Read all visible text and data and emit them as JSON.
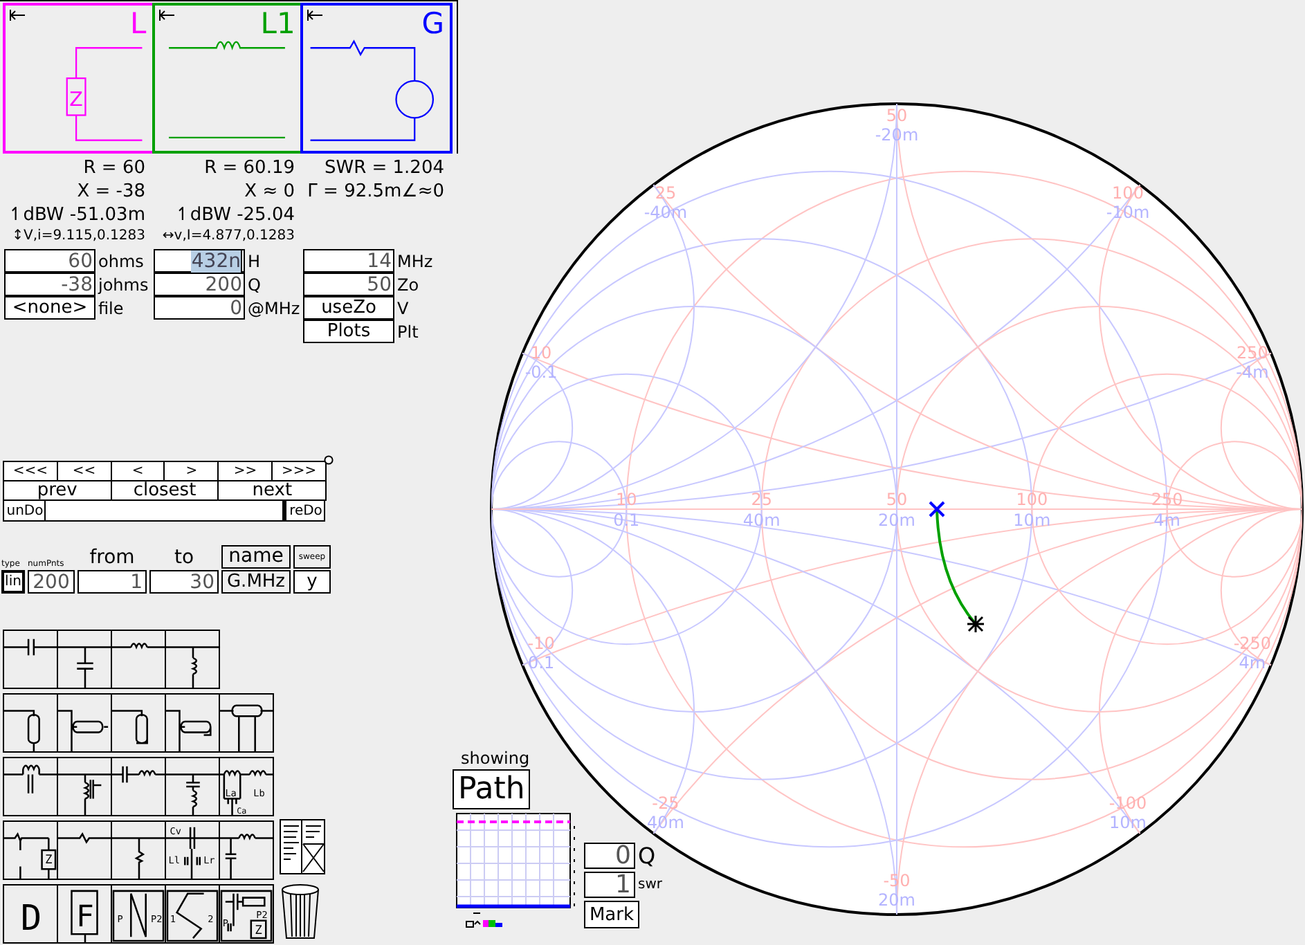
{
  "circuit": {
    "panels": [
      {
        "label": "L",
        "color": "#ff00ff",
        "kind": "load",
        "part_label": "Z"
      },
      {
        "label": "L1",
        "color": "#00a000",
        "kind": "inductor"
      },
      {
        "label": "G",
        "color": "#0000ff",
        "kind": "generator"
      }
    ]
  },
  "readouts": [
    [
      {
        "text": "R = 60",
        "kind": "main"
      },
      {
        "text": "X = -38",
        "kind": "main"
      },
      {
        "text": "↿dBW -51.03m",
        "kind": "main"
      },
      {
        "text": "↕V,i=9.115,0.1283",
        "kind": "small"
      }
    ],
    [
      {
        "text": "R = 60.19",
        "kind": "main"
      },
      {
        "text": "X ≈ 0",
        "kind": "main"
      },
      {
        "text": "↿dBW -25.04",
        "kind": "main"
      },
      {
        "text": "↔v,I=4.877,0.1283",
        "kind": "small"
      }
    ],
    [
      {
        "text": "SWR = 1.204",
        "kind": "main"
      },
      {
        "text": "Γ = 92.5m∠≈0",
        "kind": "main"
      }
    ]
  ],
  "inputs": [
    {
      "rows": [
        {
          "kind": "field",
          "value": "60",
          "unit": "ohms",
          "selected": false
        },
        {
          "kind": "field",
          "value": "-38",
          "unit": "johms",
          "selected": false
        },
        {
          "kind": "button",
          "value": "<none>",
          "unit": "file"
        }
      ]
    },
    {
      "rows": [
        {
          "kind": "field",
          "value": "432n",
          "unit": "H",
          "selected": true
        },
        {
          "kind": "field",
          "value": "200",
          "unit": "Q",
          "selected": false
        },
        {
          "kind": "field",
          "value": "0",
          "unit": "@MHz",
          "selected": false
        }
      ]
    },
    {
      "rows": [
        {
          "kind": "field",
          "value": "14",
          "unit": "MHz",
          "selected": false
        },
        {
          "kind": "field",
          "value": "50",
          "unit": "Zo",
          "selected": false
        },
        {
          "kind": "button",
          "value": "useZo",
          "unit": "V"
        },
        {
          "kind": "button",
          "value": "Plots",
          "unit": "Plt"
        }
      ]
    }
  ],
  "nav": {
    "steps": [
      "<<<",
      "<<",
      "<",
      ">",
      ">>",
      ">>>"
    ],
    "jumps": [
      "prev",
      "closest",
      "next"
    ],
    "undo": "unDo",
    "redo": "reDo"
  },
  "sweep": {
    "type_label": "type",
    "points_label": "numPnts",
    "from_label": "from",
    "to_label": "to",
    "name_label": "name",
    "sweep_label": "sweep",
    "type": "lin",
    "points": "200",
    "from": "1",
    "to": "30",
    "name": "G.MHz",
    "sweep": "y"
  },
  "palette": {
    "rows": [
      [
        {
          "kind": "series-cap"
        },
        {
          "kind": "shunt-cap"
        },
        {
          "kind": "series-ind"
        },
        {
          "kind": "shunt-ind"
        }
      ],
      [
        {
          "kind": "stub-open"
        },
        {
          "kind": "stub-side"
        },
        {
          "kind": "stub-short"
        },
        {
          "kind": "stub-side-short"
        },
        {
          "kind": "line"
        }
      ],
      [
        {
          "kind": "parallel-lc"
        },
        {
          "kind": "transformer"
        },
        {
          "kind": "series-lc"
        },
        {
          "kind": "shunt-lc"
        },
        {
          "kind": "trap",
          "labels": [
            "La",
            "Lb",
            "Ca"
          ]
        }
      ],
      [
        {
          "kind": "source",
          "labels": [
            "Z"
          ]
        },
        {
          "kind": "series-res"
        },
        {
          "kind": "shunt-res"
        },
        {
          "kind": "coupled",
          "labels": [
            "Cv",
            "Ll",
            "Lr"
          ]
        },
        {
          "kind": "pi"
        }
      ],
      [
        {
          "kind": "letter",
          "labels": [
            "D"
          ]
        },
        {
          "kind": "boxed-letter",
          "labels": [
            "F"
          ]
        },
        {
          "kind": "zigzag",
          "labels": [
            "P",
            "P2"
          ]
        },
        {
          "kind": "s-curve",
          "labels": [
            "1",
            "2"
          ]
        },
        {
          "kind": "combo",
          "labels": [
            "P",
            "P2",
            "Z"
          ]
        }
      ]
    ]
  },
  "smith": {
    "resistance_labels": [
      {
        "ohms": "10",
        "siemens": "0.1"
      },
      {
        "ohms": "25",
        "siemens": "40m"
      },
      {
        "ohms": "50",
        "siemens": "20m"
      },
      {
        "ohms": "100",
        "siemens": "10m"
      },
      {
        "ohms": "250",
        "siemens": "4m"
      }
    ],
    "upper_labels": [
      {
        "ohms": "10",
        "siemens": "-0.1"
      },
      {
        "ohms": "25",
        "siemens": "-40m"
      },
      {
        "ohms": "50",
        "siemens": "-20m"
      },
      {
        "ohms": "100",
        "siemens": "-10m"
      },
      {
        "ohms": "250",
        "siemens": "-4m"
      }
    ],
    "lower_labels": [
      {
        "ohms": "-10",
        "siemens": "0.1"
      },
      {
        "ohms": "-25",
        "siemens": "40m"
      },
      {
        "ohms": "-50",
        "siemens": "20m"
      },
      {
        "ohms": "-100",
        "siemens": "10m"
      },
      {
        "ohms": "-250",
        "siemens": "4m"
      }
    ]
  },
  "showing": {
    "label": "showing",
    "mode": "Path",
    "q": "0",
    "q_unit": "Q",
    "swr": "1",
    "swr_unit": "swr",
    "mark": "Mark"
  }
}
